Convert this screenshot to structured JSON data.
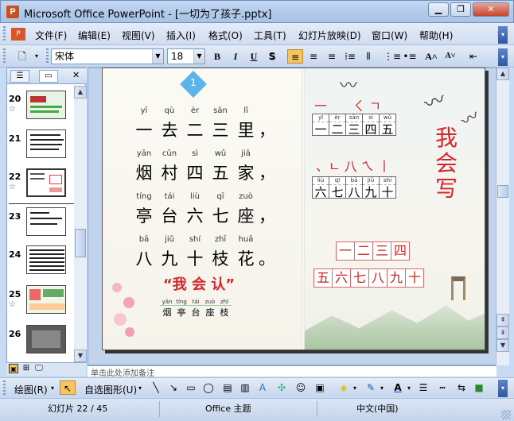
{
  "window": {
    "app_icon": "powerpoint-icon",
    "title": "Microsoft Office PowerPoint - [一切为了孩子.pptx]",
    "controls": [
      "minimize-icon",
      "restore-icon",
      "close-icon"
    ]
  },
  "menubar": {
    "items": [
      "文件(F)",
      "编辑(E)",
      "视图(V)",
      "插入(I)",
      "格式(O)",
      "工具(T)",
      "幻灯片放映(D)",
      "窗口(W)",
      "帮助(H)"
    ]
  },
  "toolbar": {
    "font_name": "宋体",
    "font_size": "18",
    "bold": "B",
    "italic": "I",
    "underline": "U",
    "shadow": "S"
  },
  "slide_panel": {
    "slides": [
      {
        "num": "20",
        "has_animation": true
      },
      {
        "num": "21",
        "has_animation": false
      },
      {
        "num": "22",
        "has_animation": true
      },
      {
        "num": "23",
        "has_animation": false
      },
      {
        "num": "24",
        "has_animation": false
      },
      {
        "num": "25",
        "has_animation": true
      },
      {
        "num": "26",
        "has_animation": false
      }
    ],
    "star": "☆"
  },
  "slide": {
    "badge": "1",
    "poem": [
      {
        "pinyin": [
          "yī",
          "qù",
          "èr",
          "sān",
          "lǐ"
        ],
        "chars": [
          "一",
          "去",
          "二",
          "三",
          "里",
          "，"
        ]
      },
      {
        "pinyin": [
          "yān",
          "cūn",
          "sì",
          "wǔ",
          "jiā"
        ],
        "chars": [
          "烟",
          "村",
          "四",
          "五",
          "家",
          "，"
        ]
      },
      {
        "pinyin": [
          "tíng",
          "tái",
          "liù",
          "qī",
          "zuò"
        ],
        "chars": [
          "亭",
          "台",
          "六",
          "七",
          "座",
          "，"
        ]
      },
      {
        "pinyin": [
          "bā",
          "jiǔ",
          "shí",
          "zhī",
          "huā"
        ],
        "chars": [
          "八",
          "九",
          "十",
          "枝",
          "花",
          "。"
        ]
      }
    ],
    "recognize_title": "“我 会 认”",
    "recognize_pinyin": [
      "yān",
      "tíng",
      "tái",
      "zuò",
      "zhī"
    ],
    "recognize_chars": [
      "烟",
      "亭",
      "台",
      "座",
      "枝"
    ],
    "strokes_row1": "一　　ㄑ ㄱ",
    "grid1": {
      "pinyin": [
        "yī",
        "èr",
        "sān",
        "sì",
        "wǔ"
      ],
      "chars": [
        "一",
        "二",
        "三",
        "四",
        "五"
      ]
    },
    "strokes_row2": "、ㄴ 八 ㄟ 丨",
    "grid2": {
      "pinyin": [
        "liù",
        "qī",
        "bā",
        "jiǔ",
        "shí"
      ],
      "chars": [
        "六",
        "七",
        "八",
        "九",
        "十"
      ]
    },
    "write_title": [
      "我",
      "会",
      "写"
    ],
    "red_grid_top": [
      "一",
      "二",
      "三",
      "四"
    ],
    "red_grid_bottom": [
      "五",
      "六",
      "七",
      "八",
      "九",
      "十"
    ]
  },
  "notes": {
    "placeholder": "单击此处添加备注"
  },
  "drawbar": {
    "draw_label": "绘图(R)",
    "autoshapes_label": "自选图形(U)"
  },
  "status": {
    "slide_info": "幻灯片 22 / 45",
    "theme": "Office 主题",
    "language": "中文(中国)"
  },
  "colors": {
    "accent_red": "#d4262b",
    "badge_blue": "#5bb5e8"
  }
}
